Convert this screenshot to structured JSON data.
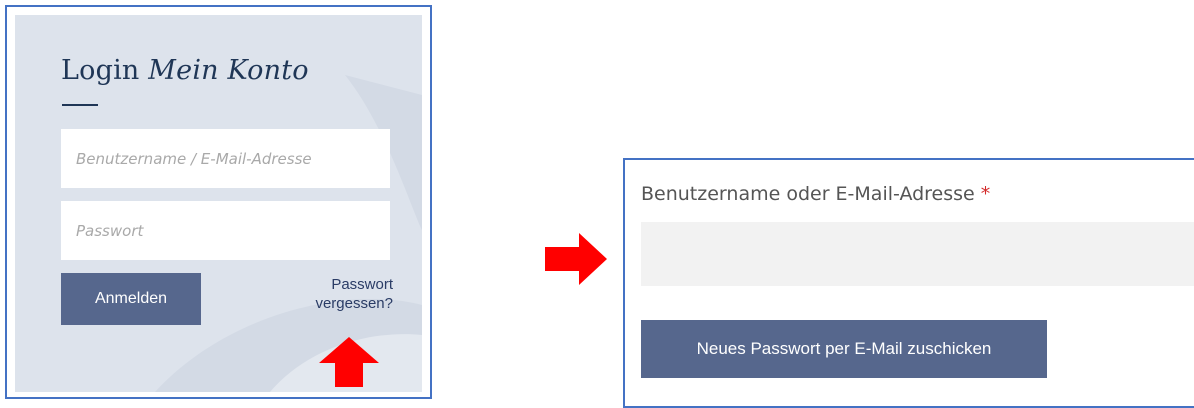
{
  "login": {
    "title_plain": "Login",
    "title_italic": "Mein Konto",
    "username_placeholder": "Benutzername / E-Mail-Adresse",
    "password_placeholder": "Passwort",
    "submit_label": "Anmelden",
    "forgot_line1": "Passwort",
    "forgot_line2": "vergessen?"
  },
  "reset": {
    "label": "Benutzername oder E-Mail-Adresse",
    "required_marker": "*",
    "submit_label": "Neues Passwort per E-Mail zuschicken"
  },
  "colors": {
    "panel_border": "#4472c4",
    "panel_background": "#dde3ec",
    "button": "#56678d",
    "title_text": "#1f3656",
    "arrow": "#ff0000",
    "required": "#d32b2b"
  },
  "icons": [
    "arrow-up-icon",
    "arrow-right-icon"
  ]
}
